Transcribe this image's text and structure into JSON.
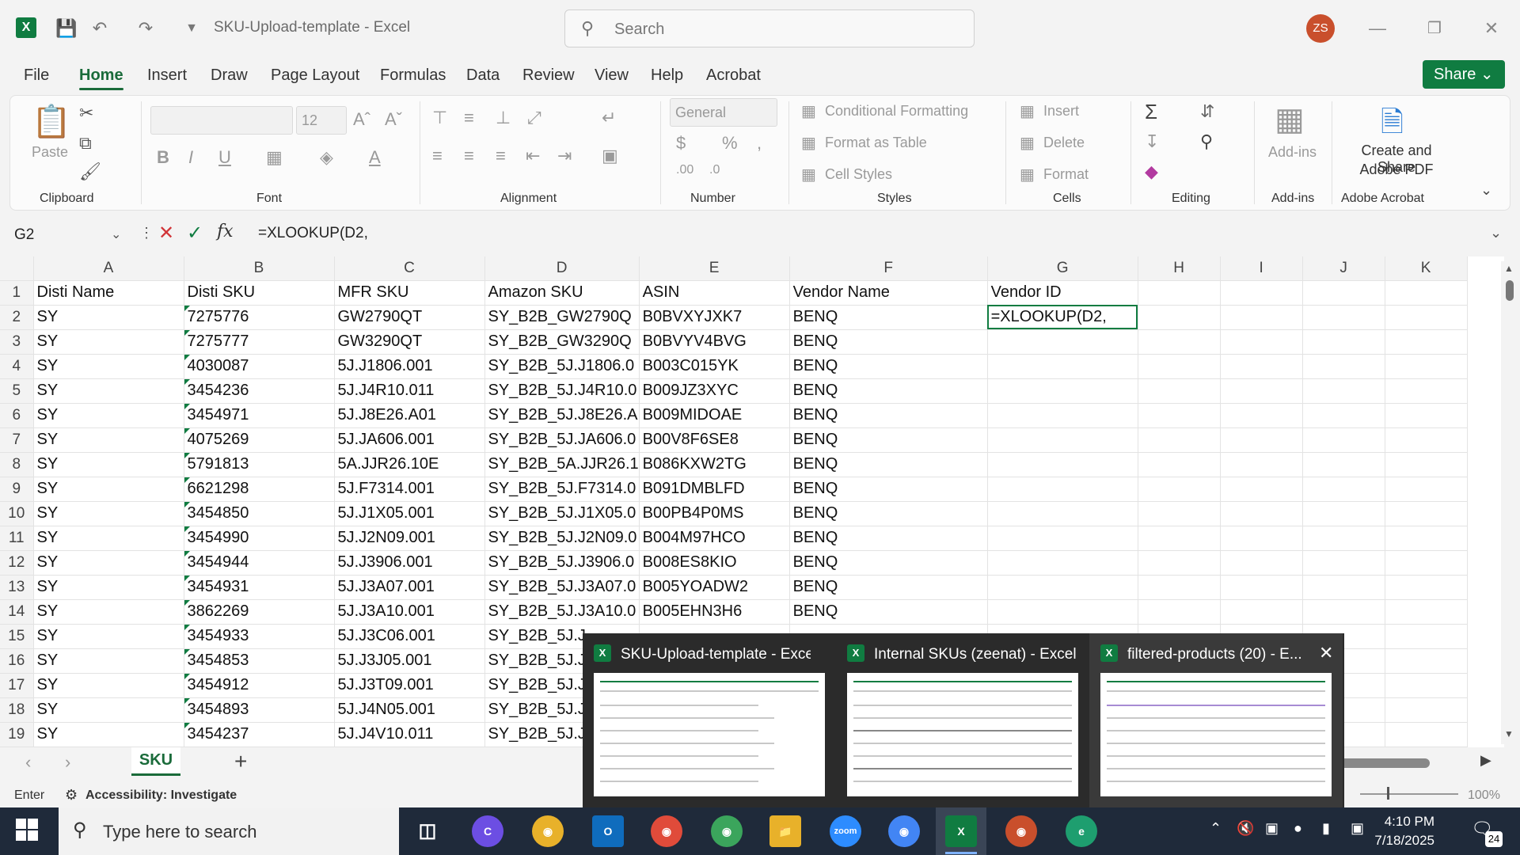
{
  "window": {
    "title": "SKU-Upload-template  -  Excel",
    "search_placeholder": "Search",
    "avatar_initials": "ZS"
  },
  "menu": {
    "tabs": [
      "File",
      "Home",
      "Insert",
      "Draw",
      "Page Layout",
      "Formulas",
      "Data",
      "Review",
      "View",
      "Help",
      "Acrobat"
    ],
    "active": "Home",
    "share_label": "Share"
  },
  "ribbon": {
    "clipboard": {
      "paste": "Paste",
      "label": "Clipboard"
    },
    "font": {
      "size": "12",
      "label": "Font"
    },
    "alignment": {
      "label": "Alignment"
    },
    "number": {
      "format": "General",
      "label": "Number"
    },
    "styles": {
      "conditional": "Conditional Formatting",
      "table": "Format as Table",
      "cell": "Cell Styles",
      "label": "Styles"
    },
    "cells": {
      "insert": "Insert",
      "delete": "Delete",
      "format": "Format",
      "label": "Cells"
    },
    "editing": {
      "label": "Editing"
    },
    "addins": {
      "button": "Add-ins",
      "label": "Add-ins"
    },
    "acrobat": {
      "line1": "Create and Share",
      "line2": "Adobe PDF",
      "label": "Adobe Acrobat"
    }
  },
  "formula_bar": {
    "name_box": "G2",
    "formula": "=XLOOKUP(D2,"
  },
  "grid": {
    "columns": [
      "A",
      "B",
      "C",
      "D",
      "E",
      "F",
      "G",
      "H",
      "I",
      "J",
      "K"
    ],
    "rows": [
      {
        "n": "1",
        "A": "Disti Name",
        "B": "Disti SKU",
        "C": "MFR SKU",
        "D": "Amazon SKU",
        "E": "ASIN",
        "F": "Vendor Name",
        "G": "Vendor ID"
      },
      {
        "n": "2",
        "A": "SY",
        "B": "7275776",
        "C": "GW2790QT",
        "D": "SY_B2B_GW2790Q",
        "E": "B0BVXYJXK7",
        "F": "BENQ",
        "G": "=XLOOKUP(D2,"
      },
      {
        "n": "3",
        "A": "SY",
        "B": "7275777",
        "C": "GW3290QT",
        "D": "SY_B2B_GW3290Q",
        "E": "B0BVYV4BVG",
        "F": "BENQ",
        "G": ""
      },
      {
        "n": "4",
        "A": "SY",
        "B": "4030087",
        "C": "5J.J1806.001",
        "D": "SY_B2B_5J.J1806.0",
        "E": "B003C015YK",
        "F": "BENQ",
        "G": ""
      },
      {
        "n": "5",
        "A": "SY",
        "B": "3454236",
        "C": "5J.J4R10.011",
        "D": "SY_B2B_5J.J4R10.0",
        "E": "B009JZ3XYC",
        "F": "BENQ",
        "G": ""
      },
      {
        "n": "6",
        "A": "SY",
        "B": "3454971",
        "C": "5J.J8E26.A01",
        "D": "SY_B2B_5J.J8E26.A",
        "E": "B009MIDOAE",
        "F": "BENQ",
        "G": ""
      },
      {
        "n": "7",
        "A": "SY",
        "B": "4075269",
        "C": "5J.JA606.001",
        "D": "SY_B2B_5J.JA606.0",
        "E": "B00V8F6SE8",
        "F": "BENQ",
        "G": ""
      },
      {
        "n": "8",
        "A": "SY",
        "B": "5791813",
        "C": "5A.JJR26.10E",
        "D": "SY_B2B_5A.JJR26.1",
        "E": "B086KXW2TG",
        "F": "BENQ",
        "G": ""
      },
      {
        "n": "9",
        "A": "SY",
        "B": "6621298",
        "C": "5J.F7314.001",
        "D": "SY_B2B_5J.F7314.0",
        "E": "B091DMBLFD",
        "F": "BENQ",
        "G": ""
      },
      {
        "n": "10",
        "A": "SY",
        "B": "3454850",
        "C": "5J.J1X05.001",
        "D": "SY_B2B_5J.J1X05.0",
        "E": "B00PB4P0MS",
        "F": "BENQ",
        "G": ""
      },
      {
        "n": "11",
        "A": "SY",
        "B": "3454990",
        "C": "5J.J2N09.001",
        "D": "SY_B2B_5J.J2N09.0",
        "E": "B004M97HCO",
        "F": "BENQ",
        "G": ""
      },
      {
        "n": "12",
        "A": "SY",
        "B": "3454944",
        "C": "5J.J3906.001",
        "D": "SY_B2B_5J.J3906.0",
        "E": "B008ES8KIO",
        "F": "BENQ",
        "G": ""
      },
      {
        "n": "13",
        "A": "SY",
        "B": "3454931",
        "C": "5J.J3A07.001",
        "D": "SY_B2B_5J.J3A07.0",
        "E": "B005YOADW2",
        "F": "BENQ",
        "G": ""
      },
      {
        "n": "14",
        "A": "SY",
        "B": "3862269",
        "C": "5J.J3A10.001",
        "D": "SY_B2B_5J.J3A10.0",
        "E": "B005EHN3H6",
        "F": "BENQ",
        "G": ""
      },
      {
        "n": "15",
        "A": "SY",
        "B": "3454933",
        "C": "5J.J3C06.001",
        "D": "SY_B2B_5J.J",
        "E": "",
        "F": "",
        "G": ""
      },
      {
        "n": "16",
        "A": "SY",
        "B": "3454853",
        "C": "5J.J3J05.001",
        "D": "SY_B2B_5J.J",
        "E": "",
        "F": "",
        "G": ""
      },
      {
        "n": "17",
        "A": "SY",
        "B": "3454912",
        "C": "5J.J3T09.001",
        "D": "SY_B2B_5J.J",
        "E": "",
        "F": "",
        "G": ""
      },
      {
        "n": "18",
        "A": "SY",
        "B": "3454893",
        "C": "5J.J4N05.001",
        "D": "SY_B2B_5J.J",
        "E": "",
        "F": "",
        "G": ""
      },
      {
        "n": "19",
        "A": "SY",
        "B": "3454237",
        "C": "5J.J4V10.011",
        "D": "SY_B2B_5J.J",
        "E": "",
        "F": "",
        "G": ""
      }
    ]
  },
  "sheet_tabs": {
    "active": "SKU",
    "add": "+"
  },
  "status": {
    "mode": "Enter",
    "accessibility": "Accessibility: Investigate",
    "zoom": "100%"
  },
  "taskbar": {
    "search_placeholder": "Type here to search",
    "time": "4:10 PM",
    "date": "7/18/2025",
    "notifications": "24"
  },
  "thumbnails": [
    {
      "title": "SKU-Upload-template - Excel"
    },
    {
      "title": "Internal SKUs (zeenat) - Excel"
    },
    {
      "title": "filtered-products (20) - E..."
    }
  ]
}
